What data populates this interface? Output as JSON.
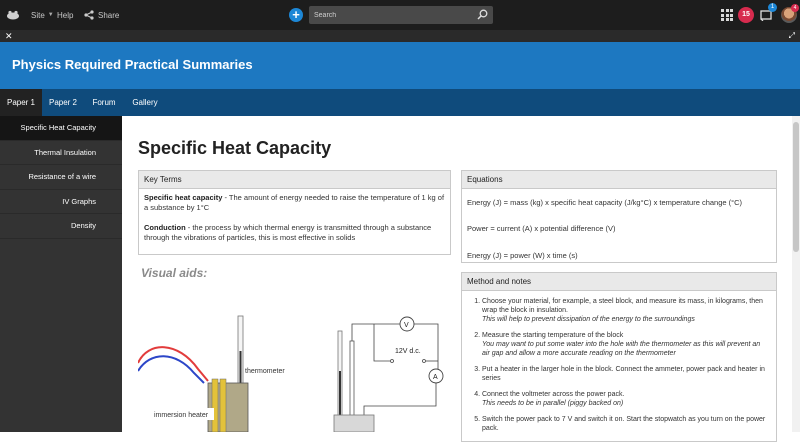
{
  "topbar": {
    "site_label": "Site",
    "help_label": "Help",
    "share_label": "Share",
    "search_placeholder": "Search",
    "notifications_count": "15",
    "messages_count": "1",
    "avatar_badge": "4"
  },
  "site": {
    "title": "Physics Required Practical Summaries"
  },
  "nav": {
    "items": [
      "Paper 1",
      "Paper 2",
      "Forum",
      "Gallery"
    ]
  },
  "sidebar": {
    "items": [
      "Specific Heat Capacity",
      "Thermal Insulation",
      "Resistance of a wire",
      "IV Graphs",
      "Density"
    ]
  },
  "page": {
    "title": "Specific Heat Capacity"
  },
  "key_terms": {
    "heading": "Key Terms",
    "term1": "Specific heat capacity",
    "def1": " - The amount of energy needed to raise the temperature of 1 kg of a substance by 1°C",
    "term2": "Conduction",
    "def2": " - the process by which thermal energy is transmitted through a substance through the vibrations of particles, this is most effective in solids"
  },
  "equations": {
    "heading": "Equations",
    "items": [
      "Energy (J) = mass (kg) x specific heat capacity (J/kg°C) x temperature change (°C)",
      "Power = current (A) x potential difference (V)",
      "Energy (J) = power (W) x time (s)"
    ]
  },
  "visual_aids": {
    "heading": "Visual aids:"
  },
  "diagram": {
    "thermometer_label": "thermometer",
    "heater_label": "immersion heater",
    "supply_label": "12V d.c.",
    "voltmeter": "V",
    "ammeter": "A"
  },
  "method": {
    "heading": "Method and notes",
    "steps": [
      {
        "text": "Choose your material, for example, a steel block, and measure its mass, in kilograms, then wrap the block in insulation.",
        "note": "This will help to prevent dissipation of the energy to the surroundings"
      },
      {
        "text": "Measure the starting temperature of the block",
        "note": "You may want to put some water into the hole with the thermometer as this will prevent an air gap and allow a more accurate reading on the thermometer"
      },
      {
        "text": "Put a heater in the larger hole in the block. Connect the ammeter, power pack and heater in series",
        "note": ""
      },
      {
        "text": "Connect the voltmeter across the power pack.",
        "note": "This needs to be in parallel (piggy backed on)"
      },
      {
        "text": "Switch the power pack to 7 V and switch it on. Start the stopwatch as you turn on the power pack.",
        "note": ""
      }
    ]
  }
}
